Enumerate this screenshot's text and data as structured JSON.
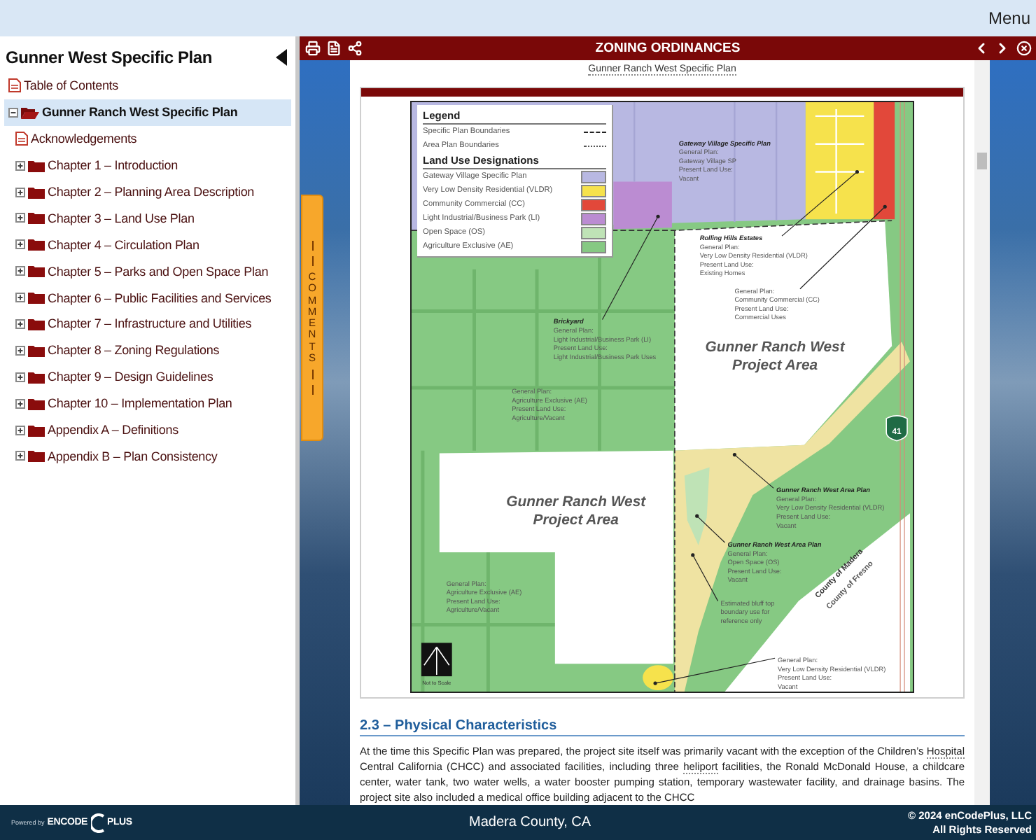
{
  "top_bar": {
    "menu_label": "Menu"
  },
  "sidebar": {
    "title": "Gunner West Specific Plan",
    "toc": [
      {
        "label": "Table of Contents",
        "kind": "document",
        "selected": false
      },
      {
        "label": "Gunner Ranch West Specific Plan",
        "kind": "folder",
        "expanded": true,
        "selected": true,
        "children": [
          {
            "label": "Acknowledgements",
            "kind": "document",
            "selected": false
          },
          {
            "label": "Chapter 1 – Introduction",
            "kind": "folder",
            "expanded": false,
            "selected": false
          },
          {
            "label": "Chapter 2 – Planning Area Description",
            "kind": "folder",
            "expanded": false,
            "selected": false
          },
          {
            "label": "Chapter 3 – Land Use Plan",
            "kind": "folder",
            "expanded": false,
            "selected": false
          },
          {
            "label": "Chapter 4 – Circulation Plan",
            "kind": "folder",
            "expanded": false,
            "selected": false
          },
          {
            "label": "Chapter 5 – Parks and Open Space Plan",
            "kind": "folder",
            "expanded": false,
            "selected": false
          },
          {
            "label": "Chapter 6 – Public Facilities and Services",
            "kind": "folder",
            "expanded": false,
            "selected": false
          },
          {
            "label": "Chapter 7 – Infrastructure and Utilities",
            "kind": "folder",
            "expanded": false,
            "selected": false
          },
          {
            "label": "Chapter 8 – Zoning Regulations",
            "kind": "folder",
            "expanded": false,
            "selected": false
          },
          {
            "label": "Chapter 9 – Design Guidelines",
            "kind": "folder",
            "expanded": false,
            "selected": false
          },
          {
            "label": "Chapter 10 – Implementation Plan",
            "kind": "folder",
            "expanded": false,
            "selected": false
          },
          {
            "label": "Appendix A – Definitions",
            "kind": "folder",
            "expanded": false,
            "selected": false
          },
          {
            "label": "Appendix B – Plan Consistency",
            "kind": "folder",
            "expanded": false,
            "selected": false
          }
        ]
      }
    ]
  },
  "comments_tab": {
    "label": "COMMENTS"
  },
  "viewer": {
    "title": "ZONING ORDINANCES",
    "document_header": "Gunner Ranch West Specific Plan",
    "map": {
      "legend": {
        "title": "Legend",
        "boundaries": [
          {
            "label": "Specific Plan Boundaries",
            "kind": "dashed"
          },
          {
            "label": "Area Plan Boundaries",
            "kind": "dotted"
          }
        ],
        "designations_title": "Land Use Designations",
        "designations": [
          {
            "label": "Gateway Village Specific Plan",
            "color": "#b8b8e2"
          },
          {
            "label": "Very Low Density Residential (VLDR)",
            "color": "#f6e24c"
          },
          {
            "label": "Community Commercial (CC)",
            "color": "#e2483a"
          },
          {
            "label": "Light Industrial/Business Park (LI)",
            "color": "#bb8cd2"
          },
          {
            "label": "Open Space (OS)",
            "color": "#bfe3b6"
          },
          {
            "label": "Agriculture Exclusive (AE)",
            "color": "#86c983"
          }
        ]
      },
      "area_titles": [
        {
          "lines": [
            "Gunner Ranch West",
            "Project Area"
          ]
        },
        {
          "lines": [
            "Gunner Ranch West",
            "Project Area"
          ]
        }
      ],
      "labels": [
        {
          "title": "Gateway Village Specific Plan",
          "lines": [
            "General Plan:",
            "Gateway Village SP",
            "Present Land Use:",
            "Vacant"
          ]
        },
        {
          "title": "Rolling Hills Estates",
          "lines": [
            "General Plan:",
            "Very Low Density Residential (VLDR)",
            "Present Land Use:",
            "Existing Homes"
          ]
        },
        {
          "lines": [
            "General Plan:",
            "Community Commercial (CC)",
            "Present Land Use:",
            "Commercial Uses"
          ]
        },
        {
          "title": "Brickyard",
          "lines": [
            "General Plan:",
            "Light Industrial/Business Park (LI)",
            "Present Land Use:",
            "Light Industrial/Business Park Uses"
          ]
        },
        {
          "lines": [
            "General Plan:",
            "Agriculture Exclusive (AE)",
            "Present Land Use:",
            "Agriculture/Vacant"
          ]
        },
        {
          "title": "Gunner Ranch West Area Plan",
          "lines": [
            "General Plan:",
            "Very Low Density Residential (VLDR)",
            "Present Land Use:",
            "Vacant"
          ]
        },
        {
          "title": "Gunner Ranch West Area Plan",
          "lines": [
            "General Plan:",
            "Open Space (OS)",
            "Present Land Use:",
            "Vacant"
          ]
        },
        {
          "lines": [
            "Estimated bluff top",
            "boundary use for",
            "reference only"
          ]
        },
        {
          "lines": [
            "General Plan:",
            "Agriculture Exclusive (AE)",
            "Present Land Use:",
            "Agriculture/Vacant"
          ]
        },
        {
          "lines": [
            "General Plan:",
            "Very Low Density Residential (VLDR)",
            "Present Land Use:",
            "Vacant"
          ]
        }
      ],
      "county_labels": [
        "County of Madera",
        "County of Fresno"
      ],
      "route_shield": "41",
      "scale_note": "Not to Scale"
    },
    "section_heading": "2.3 – Physical Characteristics",
    "paragraph": [
      {
        "text": "At the time this Specific Plan was prepared, the project site itself was primarily vacant with the exception of the Children’s "
      },
      {
        "text": "Hospital",
        "kind": "term"
      },
      {
        "text": " Central California (CHCC) and associated facilities, including three "
      },
      {
        "text": "heliport",
        "kind": "term"
      },
      {
        "text": " facilities, the Ronald McDonald House, a childcare center, water tank, two water wells, a water booster pumping station, temporary wastewater facility, and drainage basins. The project site also included a medical office building adjacent to the CHCC"
      }
    ]
  },
  "footer": {
    "logo": {
      "tagline": "Powered by",
      "name_left": "ENCODE",
      "name_right": "PLUS"
    },
    "location": "Madera County, CA",
    "copyright": "© 2024 enCodePlus, LLC",
    "rights": "All Rights Reserved"
  }
}
